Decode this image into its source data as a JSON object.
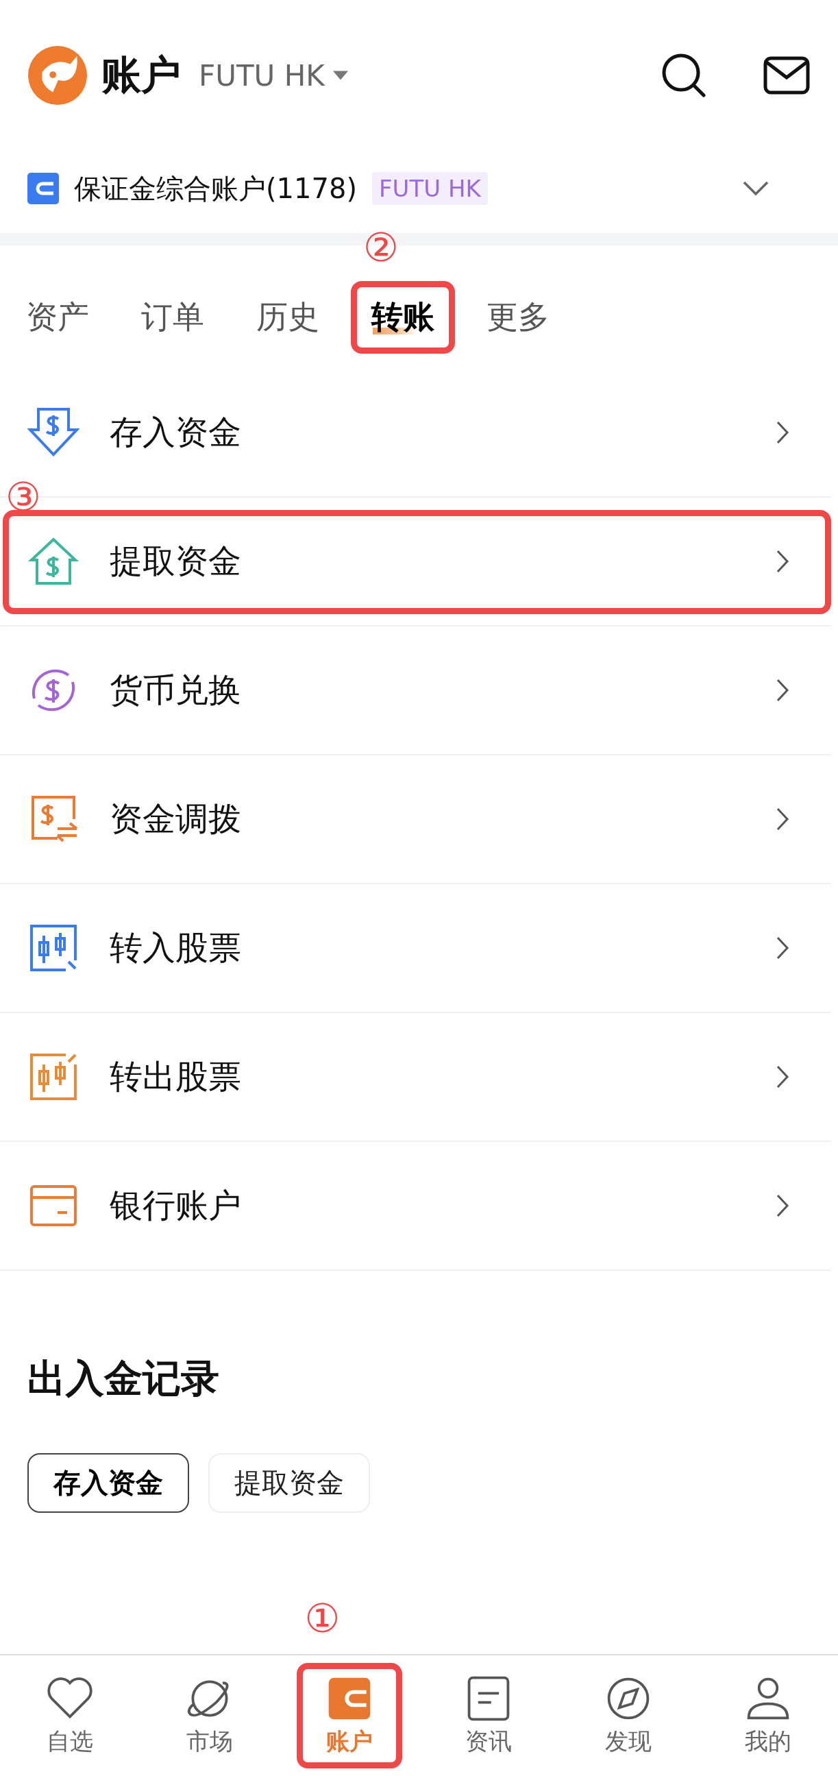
{
  "header": {
    "title": "账户",
    "broker": "FUTU HK"
  },
  "account": {
    "name": "保证金综合账户(1178)",
    "badge": "FUTU HK"
  },
  "tabs": [
    {
      "label": "资产",
      "selected": false
    },
    {
      "label": "订单",
      "selected": false
    },
    {
      "label": "历史",
      "selected": false
    },
    {
      "label": "转账",
      "selected": true,
      "callout": "②"
    },
    {
      "label": "更多",
      "selected": false
    }
  ],
  "menu": [
    {
      "label": "存入资金"
    },
    {
      "label": "提取资金",
      "callout": "③"
    },
    {
      "label": "货币兑换"
    },
    {
      "label": "资金调拨"
    },
    {
      "label": "转入股票"
    },
    {
      "label": "转出股票"
    },
    {
      "label": "银行账户"
    }
  ],
  "records": {
    "title": "出入金记录",
    "filters": [
      {
        "label": "存入资金",
        "selected": true
      },
      {
        "label": "提取资金",
        "selected": false
      }
    ]
  },
  "nav": [
    {
      "label": "自选",
      "selected": false
    },
    {
      "label": "市场",
      "selected": false
    },
    {
      "label": "账户",
      "selected": true,
      "callout": "①"
    },
    {
      "label": "资讯",
      "selected": false
    },
    {
      "label": "发现",
      "selected": false
    },
    {
      "label": "我的",
      "selected": false
    }
  ]
}
